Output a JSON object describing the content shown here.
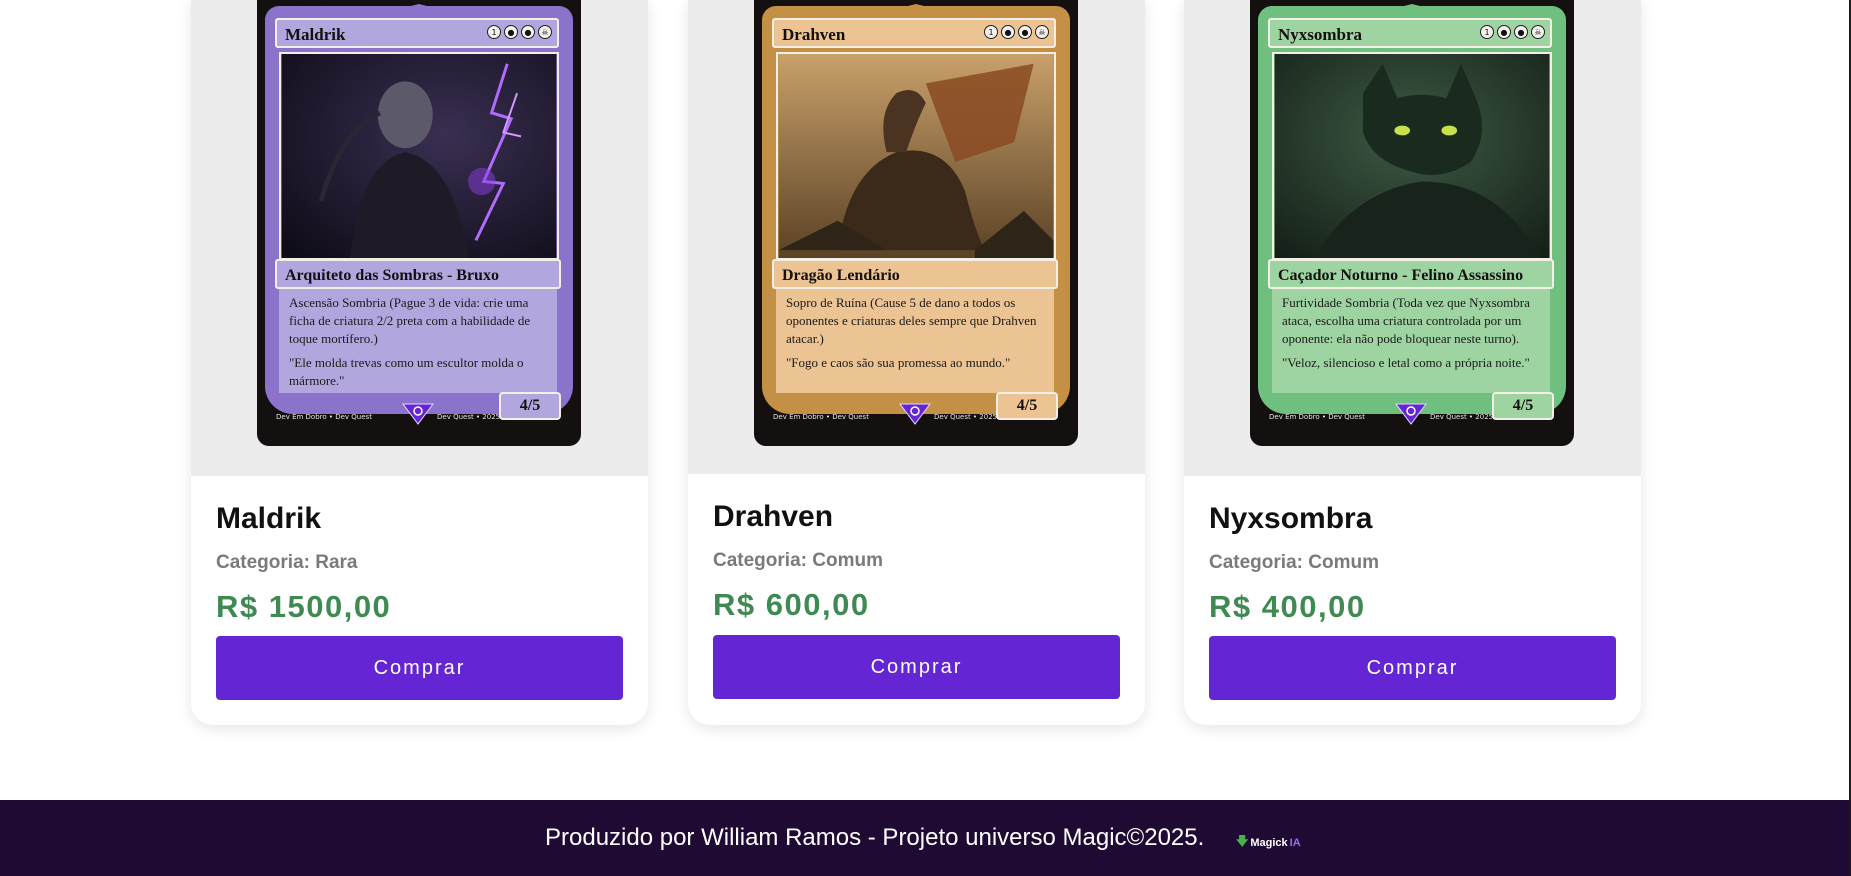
{
  "products": [
    {
      "card": {
        "name": "Maldrik",
        "cost": [
          "1",
          "💧",
          "💧",
          "☠"
        ],
        "type_line": "Arquiteto das Sombras - Bruxo",
        "rules": "Ascensão Sombria (Pague 3 de vida: crie uma ficha de criatura 2/2 preta com a habilidade de toque mortífero.)",
        "flavor": "\"Ele molda trevas como um escultor molda o mármore.\"",
        "pt": "4/5",
        "footer_left": "Dev Em Dobro • Dev Quest",
        "footer_right": "Dev Quest • 2025",
        "frame_color": "#8b73cc"
      },
      "title": "Maldrik",
      "category": "Categoria: Rara",
      "price": "R$ 1500,00",
      "buy_label": "Comprar"
    },
    {
      "card": {
        "name": "Drahven",
        "cost": [
          "1",
          "💧",
          "💧",
          "☠"
        ],
        "type_line": "Dragão Lendário",
        "rules": "Sopro de Ruína (Cause 5 de dano a todos os oponentes e criaturas deles sempre que Drahven atacar.)",
        "flavor": "\"Fogo e caos são sua promessa ao mundo.\"",
        "pt": "4/5",
        "footer_left": "Dev Em Dobro • Dev Quest",
        "footer_right": "Dev Quest • 2025",
        "frame_color": "#c49046"
      },
      "title": "Drahven",
      "category": "Categoria: Comum",
      "price": "R$ 600,00",
      "buy_label": "Comprar"
    },
    {
      "card": {
        "name": "Nyxsombra",
        "cost": [
          "1",
          "💧",
          "💧",
          "☠"
        ],
        "type_line": "Caçador Noturno - Felino Assassino",
        "rules": "Furtividade Sombria (Toda vez que Nyxsombra ataca, escolha uma criatura controlada por um oponente: ela não pode bloquear neste turno).",
        "flavor": "\"Veloz, silencioso e letal como a própria noite.\"",
        "pt": "4/5",
        "footer_left": "Dev Em Dobro • Dev Quest",
        "footer_right": "Dev Quest • 2025",
        "frame_color": "#6fbf7e"
      },
      "title": "Nyxsombra",
      "category": "Categoria: Comum",
      "price": "R$ 400,00",
      "buy_label": "Comprar"
    }
  ],
  "footer": {
    "text": "Produzido por William Ramos - Projeto universo Magic©2025.",
    "logo_word": "Magick",
    "logo_suffix": "IA"
  },
  "colors": {
    "accent": "#6426d4",
    "price": "#3f8a52",
    "footer_bg": "#1e0a33"
  }
}
